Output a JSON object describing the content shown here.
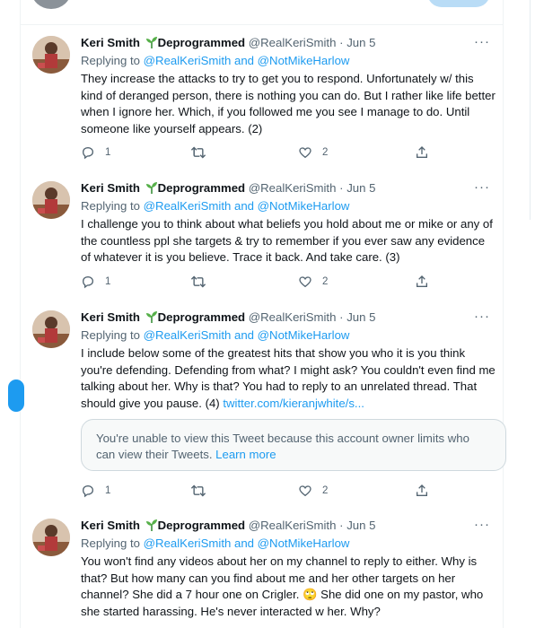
{
  "top": {
    "text": ""
  },
  "tweets": [
    {
      "name": "Keri Smith",
      "name_suffix": "Deprogrammed",
      "handle": "@RealKeriSmith",
      "date": "Jun 5",
      "reply_prefix": "Replying to",
      "reply_to": "@RealKeriSmith and @NotMikeHarlow",
      "text": "They increase the attacks to try to get you to respond. Unfortunately w/ this kind of deranged person, there is nothing you can do. But I rather like life better when I ignore her. Which, if you followed me you see I manage to do. Until someone like yourself appears. (2)",
      "replies": "1",
      "retweets": "",
      "likes": "2"
    },
    {
      "name": "Keri Smith",
      "name_suffix": "Deprogrammed",
      "handle": "@RealKeriSmith",
      "date": "Jun 5",
      "reply_prefix": "Replying to",
      "reply_to": "@RealKeriSmith and @NotMikeHarlow",
      "text": "I challenge you to think about what beliefs you hold about me or mike or any of the countless ppl she targets & try to remember if you ever saw any evidence of whatever it is you believe. Trace it back. And take care. (3)",
      "replies": "1",
      "retweets": "",
      "likes": "2"
    },
    {
      "name": "Keri Smith",
      "name_suffix": "Deprogrammed",
      "handle": "@RealKeriSmith",
      "date": "Jun 5",
      "reply_prefix": "Replying to",
      "reply_to": "@RealKeriSmith and @NotMikeHarlow",
      "text": "I include below some of the greatest hits that show you who it is you think you're defending. Defending from what? I might ask? You couldn't even find me talking about her. Why is that? You had to reply to an unrelated thread. That should give you pause. (4) ",
      "link": "twitter.com/kieranjwhite/s...",
      "quote_text": "You're unable to view this Tweet because this account owner limits who can view their Tweets. ",
      "quote_link": "Learn more",
      "replies": "1",
      "retweets": "",
      "likes": "2"
    },
    {
      "name": "Keri Smith",
      "name_suffix": "Deprogrammed",
      "handle": "@RealKeriSmith",
      "date": "Jun 5",
      "reply_prefix": "Replying to",
      "reply_to": "@RealKeriSmith and @NotMikeHarlow",
      "text": "You won't find any videos about her on my channel to reply to either. Why is that? But how many can you find about me and her other targets on her channel? She did a 7 hour one on Crigler. 🙄 She did one on my pastor, who she started harassing. He's never interacted w her. Why?"
    }
  ],
  "ui": {
    "separator": "·",
    "more": "···"
  },
  "colors": {
    "link": "#1d9bf0",
    "muted": "#536471",
    "text": "#0f1419"
  }
}
